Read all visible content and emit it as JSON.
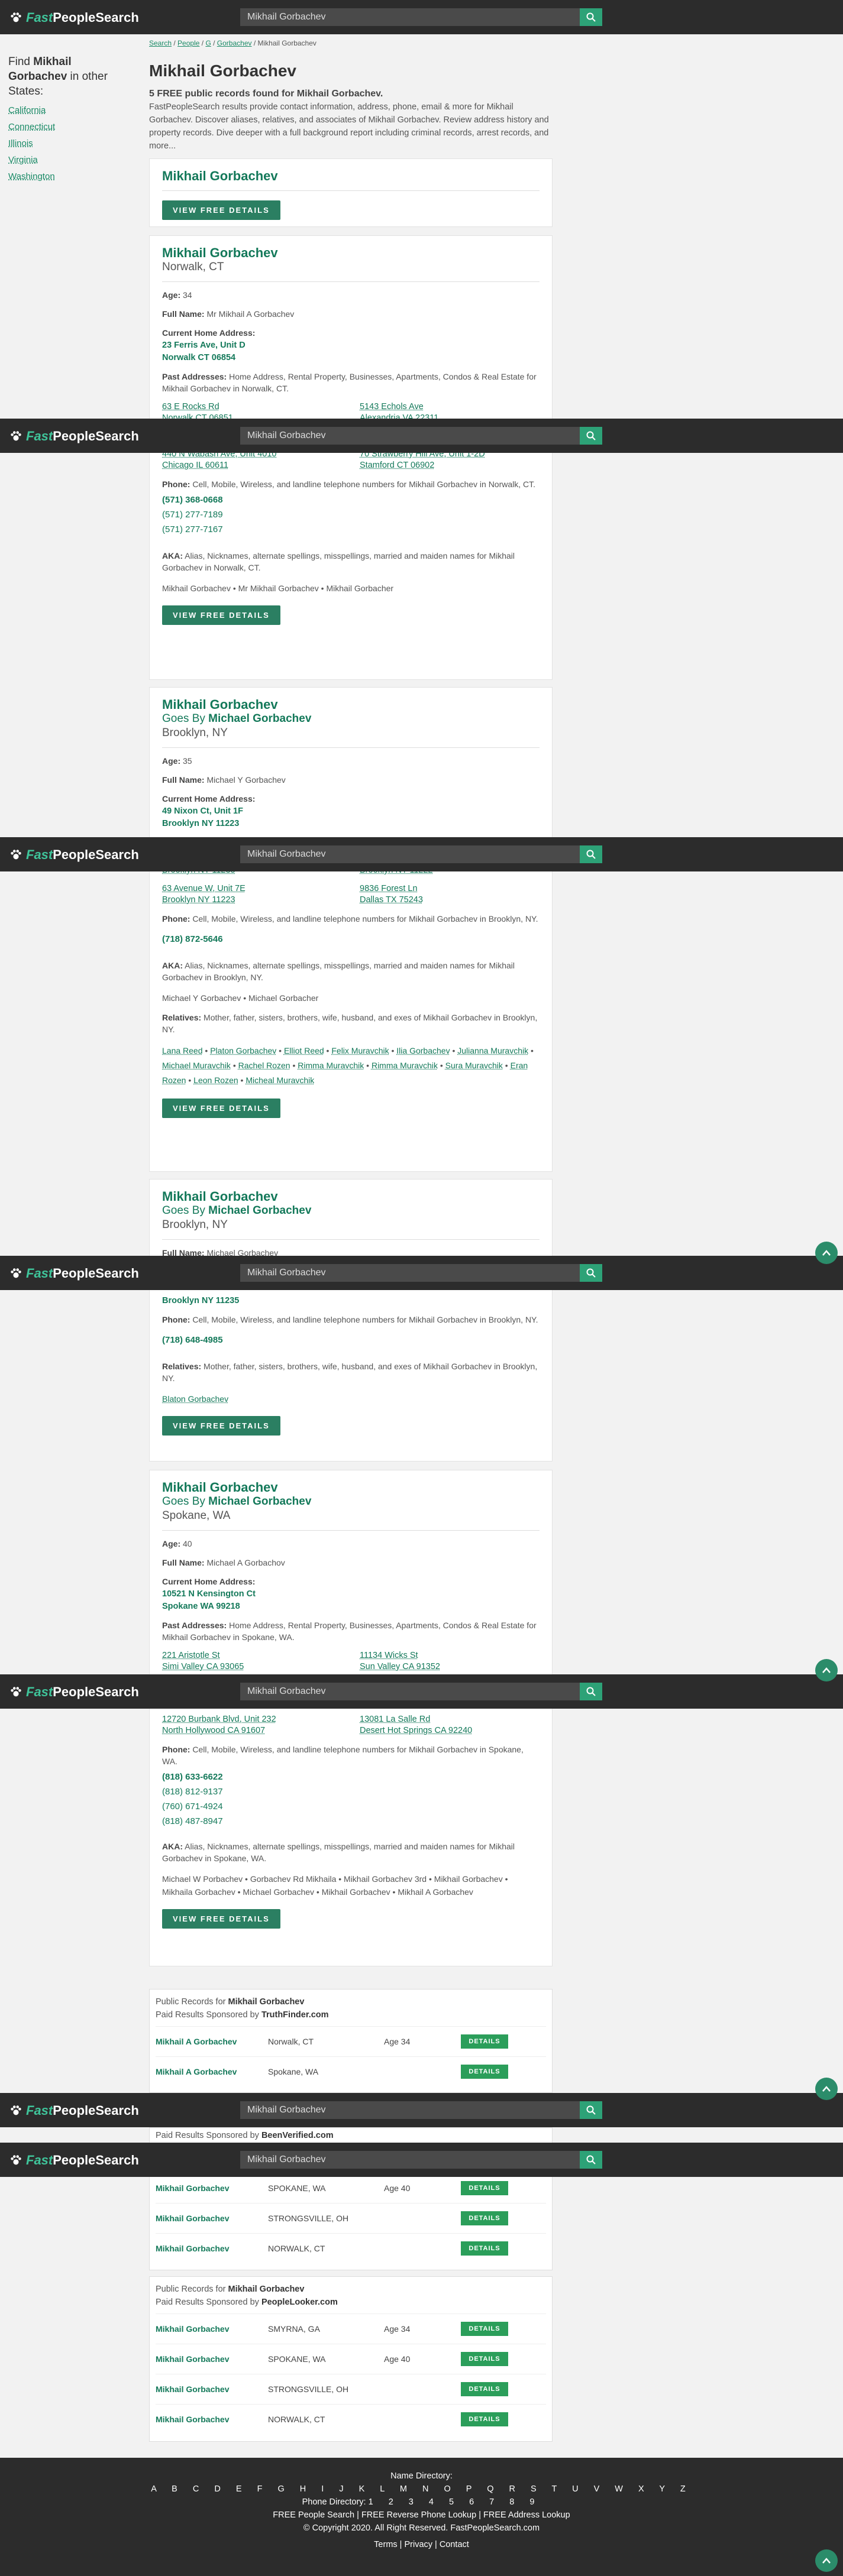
{
  "app": {
    "brand_fast": "Fast",
    "brand_rest": "PeopleSearch",
    "search_value": "Mikhail Gorbachev"
  },
  "sidebar": {
    "heading_pre": "Find ",
    "heading_name": "Mikhail Gorbachev",
    "heading_post": " in other States:",
    "states": [
      "California",
      "Connecticut",
      "Illinois",
      "Virginia",
      "Washington"
    ]
  },
  "breadcrumb": [
    "Search",
    "People",
    "G",
    "Gorbachev",
    "Mikhail Gorbachev"
  ],
  "page": {
    "title": "Mikhail Gorbachev",
    "intro_bold": "5 FREE public records found for Mikhail Gorbachev.",
    "intro": "FastPeopleSearch results provide contact information, address, phone, email & more for Mikhail Gorbachev. Discover aliases, relatives, and associates of Mikhail Gorbachev. Review address history and property records. Dive deeper with a full background report including criminal records, arrest records, and more..."
  },
  "labels": {
    "view": "VIEW FREE DETAILS",
    "age": "Age:",
    "full": "Full Name:",
    "current": "Current Home Address:",
    "past": "Past Addresses:",
    "phone": "Phone:",
    "aka": "AKA:",
    "relatives": "Relatives:",
    "goes_by": "Goes By "
  },
  "top_card": {
    "name": "Mikhail Gorbachev"
  },
  "cards": [
    {
      "name": "Mikhail Gorbachev",
      "location": "Norwalk, CT",
      "age": "34",
      "full_name": "Mr Mikhail A Gorbachev",
      "address1": "23 Ferris Ave, Unit D",
      "address2": "Norwalk CT 06854",
      "past_desc": "Home Address, Rental Property, Businesses, Apartments, Condos & Real Estate for Mikhail Gorbachev in Norwalk, CT.",
      "past": [
        [
          "63 E Rocks Rd",
          "Norwalk CT 06851"
        ],
        [
          "5143 Echols Ave",
          "Alexandria VA 22311"
        ],
        [
          "440 N Wabash Ave, Unit 4010",
          "Chicago IL 60611"
        ],
        [
          "70 Strawberry Hill Ave, Unit 1-2D",
          "Stamford CT 06902"
        ]
      ],
      "phone_desc": "Cell, Mobile, Wireless, and landline telephone numbers for Mikhail Gorbachev in Norwalk, CT.",
      "phones": [
        "(571) 368-0668",
        "(571) 277-7189",
        "(571) 277-7167"
      ],
      "aka_desc": "Alias, Nicknames, alternate spellings, misspellings, married and maiden names for Mikhail Gorbachev in Norwalk, CT.",
      "aka": "Mikhail Gorbachev • Mr Mikhail Gorbachev • Mikhail Gorbacher"
    },
    {
      "name": "Mikhail Gorbachev",
      "goes_by": "Michael Gorbachev",
      "location": "Brooklyn, NY",
      "age": "35",
      "full_name": "Michael Y Gorbachev",
      "address1": "49 Nixon Ct, Unit 1F",
      "address2": "Brooklyn NY 11223",
      "past_top_a": "Brooklyn NY 11235",
      "past_top_b": "Brooklyn NY 11222",
      "past": [
        [
          "63 Avenue W, Unit 7E",
          "Brooklyn NY 11223"
        ],
        [
          "9836 Forest Ln",
          "Dallas TX 75243"
        ]
      ],
      "phone_desc": "Cell, Mobile, Wireless, and landline telephone numbers for Mikhail Gorbachev in Brooklyn, NY.",
      "phones": [
        "(718) 872-5646"
      ],
      "aka_desc": "Alias, Nicknames, alternate spellings, misspellings, married and maiden names for Mikhail Gorbachev in Brooklyn, NY.",
      "aka": "Michael Y Gorbachev • Michael Gorbacher",
      "rel_desc": "Mother, father, sisters, brothers, wife, husband, and exes of Mikhail Gorbachev in Brooklyn, NY.",
      "relatives": [
        "Lana Reed",
        "Platon Gorbachev",
        "Elliot Reed",
        "Felix Muravchik",
        "Ilia Gorbachev",
        "Julianna Muravchik",
        "Michael Muravchik",
        "Rachel Rozen",
        "Rimma Muravchik",
        "Rimma Muravchik",
        "Sura Muravchik",
        "Eran Rozen",
        "Leon Rozen",
        "Micheal Muravchik"
      ]
    },
    {
      "name": "Mikhail Gorbachev",
      "goes_by": "Michael Gorbachev",
      "location": "Brooklyn, NY",
      "full_name": "Michael Gorbachev",
      "addr_tail": "Brooklyn NY 11235",
      "phone_desc": "Cell, Mobile, Wireless, and landline telephone numbers for Mikhail Gorbachev in Brooklyn, NY.",
      "phones": [
        "(718) 648-4985"
      ],
      "rel_desc": "Mother, father, sisters, brothers, wife, husband, and exes of Mikhail Gorbachev in Brooklyn, NY.",
      "relatives": [
        "Blaton Gorbachev"
      ]
    },
    {
      "name": "Mikhail Gorbachev",
      "goes_by": "Michael Gorbachev",
      "location": "Spokane, WA",
      "age": "40",
      "full_name": "Michael A Gorbachov",
      "address1": "10521 N Kensington Ct",
      "address2": "Spokane WA 99218",
      "past_desc": "Home Address, Rental Property, Businesses, Apartments, Condos & Real Estate for Mikhail Gorbachev in Spokane, WA.",
      "past": [
        [
          "221 Aristotle St",
          "Simi Valley CA 93065"
        ],
        [
          "11134 Wicks St",
          "Sun Valley CA 91352"
        ],
        [
          "12720 Burbank Blvd, Unit 232",
          "North Hollywood CA 91607"
        ],
        [
          "13081 La Salle Rd",
          "Desert Hot Springs CA 92240"
        ]
      ],
      "phone_desc": "Cell, Mobile, Wireless, and landline telephone numbers for Mikhail Gorbachev in Spokane, WA.",
      "phones": [
        "(818) 633-6622",
        "(818) 812-9137",
        "(760) 671-4924",
        "(818) 487-8947"
      ],
      "aka_desc": "Alias, Nicknames, alternate spellings, misspellings, married and maiden names for Mikhail Gorbachev in Spokane, WA.",
      "aka": "Michael W Porbachev • Gorbachev Rd Mikhaila • Mikhail Gorbachev 3rd • Mikhail Gorbachev • Mikhaila Gorbachev • Michael Gorbachev • Mikhail Gorbachev • Mikhail A Gorbachev"
    }
  ],
  "sponsored": [
    {
      "pre": "Public Records for ",
      "name": "Mikhail Gorbachev",
      "sp": "Paid Results Sponsored by ",
      "by": "TruthFinder.com",
      "rows": [
        [
          "Mikhail A Gorbachev",
          "Norwalk, CT",
          "Age 34"
        ],
        [
          "Mikhail A Gorbachev",
          "Spokane, WA",
          ""
        ]
      ]
    },
    {
      "sp": "Paid Results Sponsored by ",
      "by": "BeenVerified.com",
      "rows": [
        [
          "Mikhail Gorbachev",
          "SPOKANE, WA",
          "Age 40"
        ],
        [
          "Mikhail Gorbachev",
          "STRONGSVILLE, OH",
          ""
        ],
        [
          "Mikhail Gorbachev",
          "NORWALK, CT",
          ""
        ]
      ]
    },
    {
      "pre": "Public Records for ",
      "name": "Mikhail Gorbachev",
      "sp": "Paid Results Sponsored by ",
      "by": "PeopleLooker.com",
      "rows": [
        [
          "Mikhail Gorbachev",
          "SMYRNA, GA",
          "Age 34"
        ],
        [
          "Mikhail Gorbachev",
          "SPOKANE, WA",
          "Age 40"
        ],
        [
          "Mikhail Gorbachev",
          "STRONGSVILLE, OH",
          ""
        ],
        [
          "Mikhail Gorbachev",
          "NORWALK, CT",
          ""
        ]
      ]
    }
  ],
  "details_label": "DETAILS",
  "footer": {
    "name_dir": "Name Directory:",
    "letters": "A B C D E F G H I J K L M N O P Q R S T U V W X Y Z",
    "phone_dir": "Phone Directory:",
    "digits": "1 2 3 4 5 6 7 8 9",
    "links": "FREE People Search | FREE Reverse Phone Lookup | FREE Address Lookup",
    "copyright": "© Copyright 2020. All Right Reserved. FastPeopleSearch.com",
    "legal": "Terms | Privacy | Contact"
  }
}
